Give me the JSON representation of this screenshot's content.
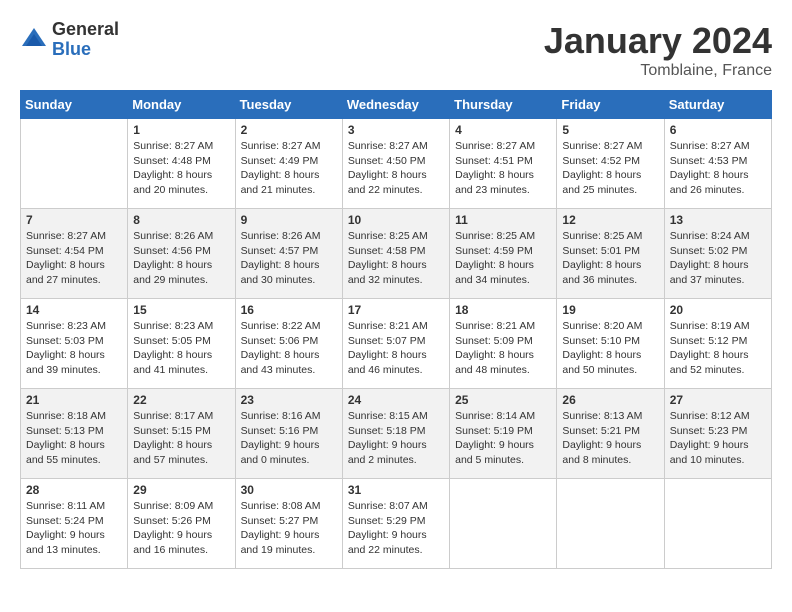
{
  "header": {
    "logo_general": "General",
    "logo_blue": "Blue",
    "month_title": "January 2024",
    "location": "Tomblaine, France"
  },
  "days_of_week": [
    "Sunday",
    "Monday",
    "Tuesday",
    "Wednesday",
    "Thursday",
    "Friday",
    "Saturday"
  ],
  "weeks": [
    [
      {
        "day": "",
        "info": ""
      },
      {
        "day": "1",
        "info": "Sunrise: 8:27 AM\nSunset: 4:48 PM\nDaylight: 8 hours\nand 20 minutes."
      },
      {
        "day": "2",
        "info": "Sunrise: 8:27 AM\nSunset: 4:49 PM\nDaylight: 8 hours\nand 21 minutes."
      },
      {
        "day": "3",
        "info": "Sunrise: 8:27 AM\nSunset: 4:50 PM\nDaylight: 8 hours\nand 22 minutes."
      },
      {
        "day": "4",
        "info": "Sunrise: 8:27 AM\nSunset: 4:51 PM\nDaylight: 8 hours\nand 23 minutes."
      },
      {
        "day": "5",
        "info": "Sunrise: 8:27 AM\nSunset: 4:52 PM\nDaylight: 8 hours\nand 25 minutes."
      },
      {
        "day": "6",
        "info": "Sunrise: 8:27 AM\nSunset: 4:53 PM\nDaylight: 8 hours\nand 26 minutes."
      }
    ],
    [
      {
        "day": "7",
        "info": "Sunrise: 8:27 AM\nSunset: 4:54 PM\nDaylight: 8 hours\nand 27 minutes."
      },
      {
        "day": "8",
        "info": "Sunrise: 8:26 AM\nSunset: 4:56 PM\nDaylight: 8 hours\nand 29 minutes."
      },
      {
        "day": "9",
        "info": "Sunrise: 8:26 AM\nSunset: 4:57 PM\nDaylight: 8 hours\nand 30 minutes."
      },
      {
        "day": "10",
        "info": "Sunrise: 8:25 AM\nSunset: 4:58 PM\nDaylight: 8 hours\nand 32 minutes."
      },
      {
        "day": "11",
        "info": "Sunrise: 8:25 AM\nSunset: 4:59 PM\nDaylight: 8 hours\nand 34 minutes."
      },
      {
        "day": "12",
        "info": "Sunrise: 8:25 AM\nSunset: 5:01 PM\nDaylight: 8 hours\nand 36 minutes."
      },
      {
        "day": "13",
        "info": "Sunrise: 8:24 AM\nSunset: 5:02 PM\nDaylight: 8 hours\nand 37 minutes."
      }
    ],
    [
      {
        "day": "14",
        "info": "Sunrise: 8:23 AM\nSunset: 5:03 PM\nDaylight: 8 hours\nand 39 minutes."
      },
      {
        "day": "15",
        "info": "Sunrise: 8:23 AM\nSunset: 5:05 PM\nDaylight: 8 hours\nand 41 minutes."
      },
      {
        "day": "16",
        "info": "Sunrise: 8:22 AM\nSunset: 5:06 PM\nDaylight: 8 hours\nand 43 minutes."
      },
      {
        "day": "17",
        "info": "Sunrise: 8:21 AM\nSunset: 5:07 PM\nDaylight: 8 hours\nand 46 minutes."
      },
      {
        "day": "18",
        "info": "Sunrise: 8:21 AM\nSunset: 5:09 PM\nDaylight: 8 hours\nand 48 minutes."
      },
      {
        "day": "19",
        "info": "Sunrise: 8:20 AM\nSunset: 5:10 PM\nDaylight: 8 hours\nand 50 minutes."
      },
      {
        "day": "20",
        "info": "Sunrise: 8:19 AM\nSunset: 5:12 PM\nDaylight: 8 hours\nand 52 minutes."
      }
    ],
    [
      {
        "day": "21",
        "info": "Sunrise: 8:18 AM\nSunset: 5:13 PM\nDaylight: 8 hours\nand 55 minutes."
      },
      {
        "day": "22",
        "info": "Sunrise: 8:17 AM\nSunset: 5:15 PM\nDaylight: 8 hours\nand 57 minutes."
      },
      {
        "day": "23",
        "info": "Sunrise: 8:16 AM\nSunset: 5:16 PM\nDaylight: 9 hours\nand 0 minutes."
      },
      {
        "day": "24",
        "info": "Sunrise: 8:15 AM\nSunset: 5:18 PM\nDaylight: 9 hours\nand 2 minutes."
      },
      {
        "day": "25",
        "info": "Sunrise: 8:14 AM\nSunset: 5:19 PM\nDaylight: 9 hours\nand 5 minutes."
      },
      {
        "day": "26",
        "info": "Sunrise: 8:13 AM\nSunset: 5:21 PM\nDaylight: 9 hours\nand 8 minutes."
      },
      {
        "day": "27",
        "info": "Sunrise: 8:12 AM\nSunset: 5:23 PM\nDaylight: 9 hours\nand 10 minutes."
      }
    ],
    [
      {
        "day": "28",
        "info": "Sunrise: 8:11 AM\nSunset: 5:24 PM\nDaylight: 9 hours\nand 13 minutes."
      },
      {
        "day": "29",
        "info": "Sunrise: 8:09 AM\nSunset: 5:26 PM\nDaylight: 9 hours\nand 16 minutes."
      },
      {
        "day": "30",
        "info": "Sunrise: 8:08 AM\nSunset: 5:27 PM\nDaylight: 9 hours\nand 19 minutes."
      },
      {
        "day": "31",
        "info": "Sunrise: 8:07 AM\nSunset: 5:29 PM\nDaylight: 9 hours\nand 22 minutes."
      },
      {
        "day": "",
        "info": ""
      },
      {
        "day": "",
        "info": ""
      },
      {
        "day": "",
        "info": ""
      }
    ]
  ]
}
